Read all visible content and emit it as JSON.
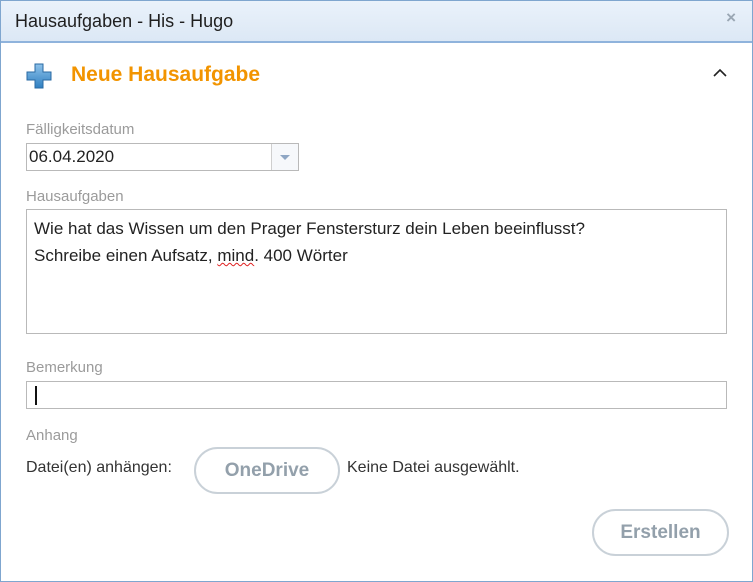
{
  "window": {
    "title": "Hausaufgaben - His - Hugo",
    "close_glyph": "×"
  },
  "section": {
    "title": "Neue Hausaufgabe",
    "icon": "plus-icon",
    "collapse_icon": "chevron-up-icon",
    "accent": "#f29400"
  },
  "due_date": {
    "label": "Fälligkeitsdatum",
    "value": "06.04.2020"
  },
  "homework": {
    "label": "Hausaufgaben",
    "line1": "Wie hat das Wissen um den Prager Fenstersturz dein Leben beeinflusst?",
    "line2_pre": "Schreibe einen Aufsatz, ",
    "line2_spell": "mind",
    "line2_post": ". 400 Wörter"
  },
  "remark": {
    "label": "Bemerkung",
    "value": ""
  },
  "attachment": {
    "label": "Anhang",
    "attach_text": "Datei(en) anhängen:",
    "onedrive_label": "OneDrive",
    "no_file_text": "Keine Datei ausgewählt."
  },
  "actions": {
    "create_label": "Erstellen"
  }
}
